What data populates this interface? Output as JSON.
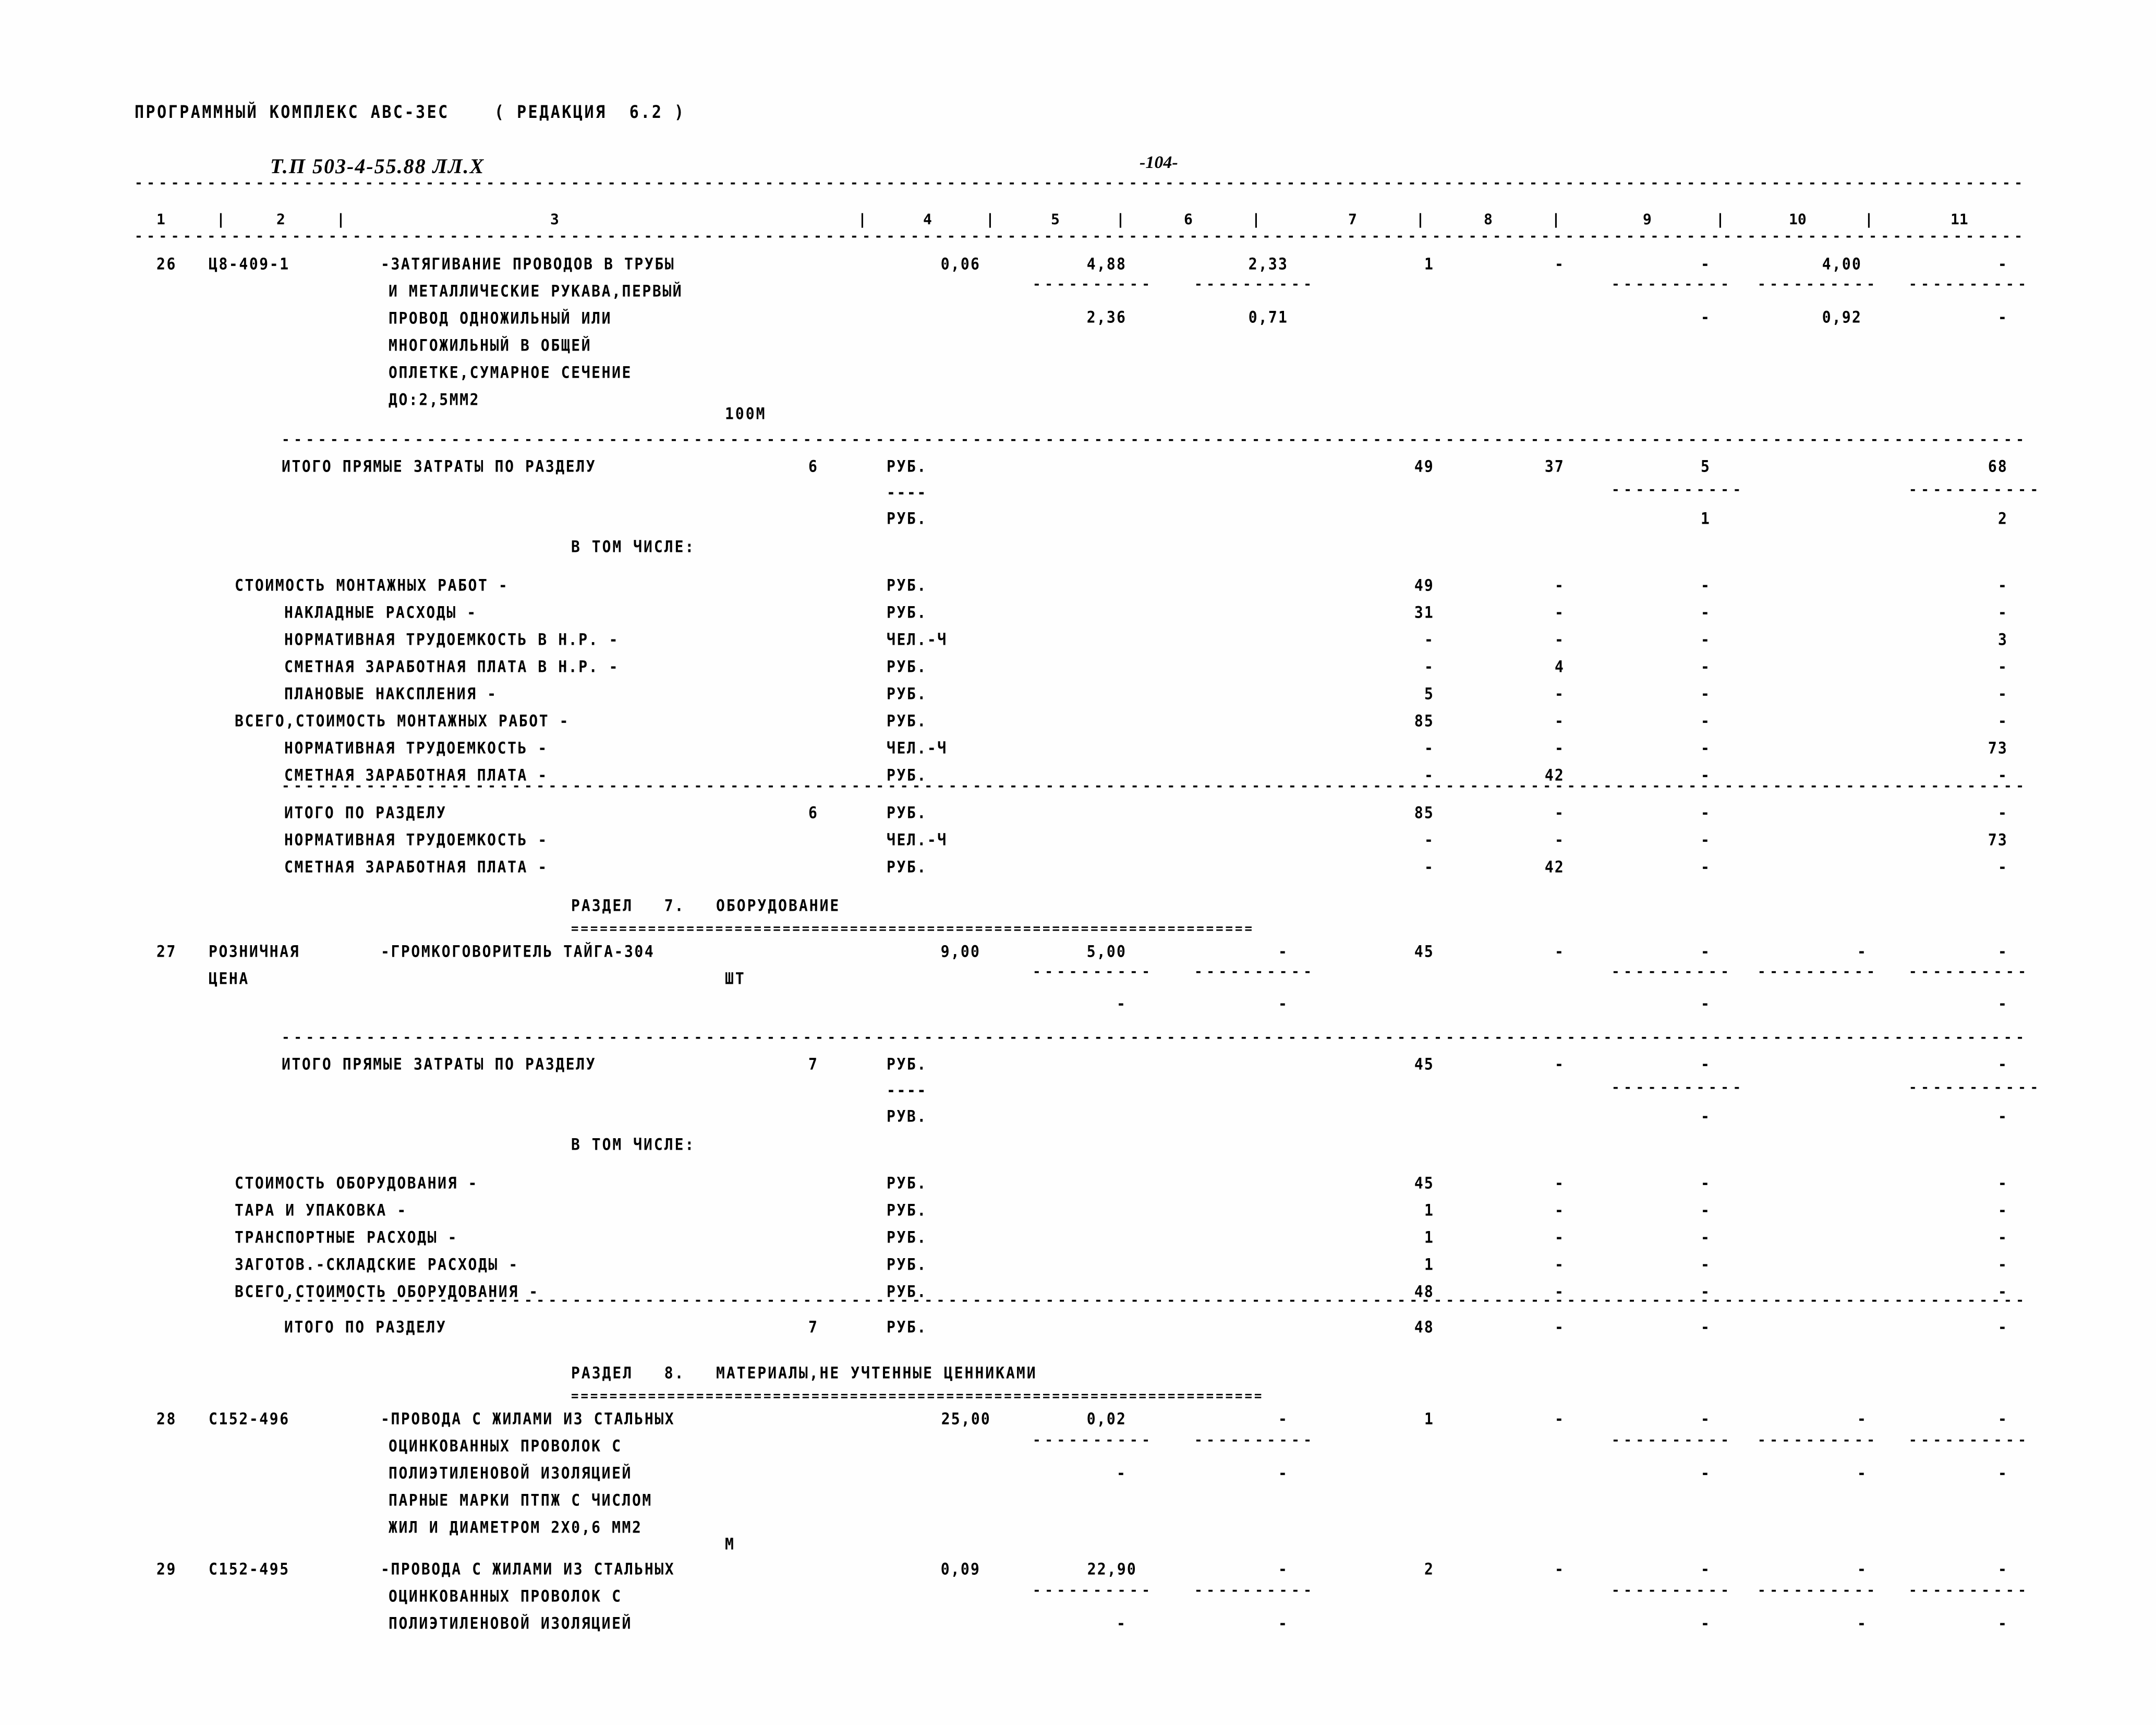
{
  "header": {
    "program_line": "ПРОГРАММНЫЙ КОМПЛЕКС АВС-ЗЕС    ( РЕДАКЦИЯ  6.2 )",
    "doc_code": "Т.П 503-4-55.88 ЛЛ.Х",
    "page_number": "-104-"
  },
  "column_headers": [
    "1",
    "2",
    "3",
    "4",
    "5",
    "6",
    "7",
    "8",
    "9",
    "10",
    "11"
  ],
  "rules": {
    "dash": "-",
    "equals": "="
  },
  "items": [
    {
      "no": "26",
      "code": "Ц8-409-1",
      "desc_lines": [
        "-ЗАТЯГИВАНИЕ ПРОВОДОВ В ТРУБЫ",
        "И МЕТАЛЛИЧЕСКИЕ РУКАВА,ПЕРВЫЙ",
        "ПРОВОД ОДНОЖИЛЬНЫЙ ИЛИ",
        "МНОГОЖИЛЬНЫЙ В ОБЩЕЙ",
        "ОПЛЕТКЕ,СУМАРНОЕ СЕЧЕНИЕ",
        "ДО:2,5ММ2"
      ],
      "unit": "100М",
      "row1": {
        "c4": "0,06",
        "c5": "4,88",
        "c6": "2,33",
        "c7": "1",
        "c8": "-",
        "c9": "-",
        "c10": "4,00",
        "c11": "-"
      },
      "row2": {
        "c5": "2,36",
        "c6": "0,71",
        "c9": "-",
        "c10": "0,92",
        "c11": "-"
      }
    },
    {
      "no": "27",
      "code": "РОЗНИЧНАЯ",
      "code2": "ЦЕНА",
      "desc_lines": [
        "-ГРОМКОГОВОРИТЕЛЬ ТАЙГА-304"
      ],
      "unit": "ШТ",
      "row1": {
        "c4": "9,00",
        "c5": "5,00",
        "c6": "-",
        "c7": "45",
        "c8": "-",
        "c9": "-",
        "c10": "-",
        "c11": "-"
      },
      "row2": {
        "c5": "-",
        "c6": "-"
      }
    },
    {
      "no": "28",
      "code": "С152-496",
      "desc_lines": [
        "-ПРОВОДА С ЖИЛАМИ ИЗ СТАЛЬНЫХ",
        "ОЦИНКОВАННЫХ ПРОВОЛОК С",
        "ПОЛИЭТИЛЕНОВОЙ ИЗОЛЯЦИЕЙ",
        "ПАРНЫЕ МАРКИ ПТПЖ С ЧИСЛОМ",
        "ЖИЛ И ДИАМЕТРОМ 2Х0,6 ММ2"
      ],
      "unit": "М",
      "row1": {
        "c4": "25,00",
        "c5": "0,02",
        "c6": "-",
        "c7": "1",
        "c8": "-",
        "c9": "-",
        "c10": "-",
        "c11": "-"
      },
      "row2": {
        "c5": "-",
        "c6": "-",
        "c9": "-",
        "c10": "-",
        "c11": "-"
      }
    },
    {
      "no": "29",
      "code": "С152-495",
      "desc_lines": [
        "-ПРОВОДА С ЖИЛАМИ ИЗ СТАЛЬНЫХ",
        "ОЦИНКОВАННЫХ ПРОВОЛОК С",
        "ПОЛИЭТИЛЕНОВОЙ ИЗОЛЯЦИЕЙ"
      ],
      "row1": {
        "c4": "0,09",
        "c5": "22,90",
        "c6": "-",
        "c7": "2",
        "c8": "-",
        "c9": "-",
        "c10": "-",
        "c11": "-"
      },
      "row2": {
        "c5": "-",
        "c6": "-",
        "c9": "-",
        "c10": "-",
        "c11": "-"
      }
    }
  ],
  "section6": {
    "total_direct_label": "ИТОГО ПРЯМЫЕ ЗАТРАТЫ ПО РАЗДЕЛУ",
    "total_direct_no": "6",
    "unit_rub": "РУБ.",
    "unit_rub2": "РУБ.",
    "dash_mark": "----",
    "values_main": {
      "c7": "49",
      "c8": "37",
      "c9": "5",
      "c11": "68"
    },
    "values_sub": {
      "c9": "1",
      "c11": "2"
    },
    "in_which_label": "В ТОМ ЧИСЛЕ:",
    "detail_rows": [
      {
        "label": "СТОИМОСТЬ МОНТАЖНЫХ РАБОТ -",
        "indent": 0,
        "unit": "РУБ.",
        "c7": "49",
        "c8": "-",
        "c9": "-",
        "c11": "-"
      },
      {
        "label": "НАКЛАДНЫЕ РАСХОДЫ -",
        "indent": 1,
        "unit": "РУБ.",
        "c7": "31",
        "c8": "-",
        "c9": "-",
        "c11": "-"
      },
      {
        "label": "НОРМАТИВНАЯ ТРУДОЕМКОСТЬ В Н.Р. -",
        "indent": 1,
        "unit": "ЧЕЛ.-Ч",
        "c7": "-",
        "c8": "-",
        "c9": "-",
        "c11": "3"
      },
      {
        "label": "СМЕТНАЯ ЗАРАБОТНАЯ ПЛАТА В Н.Р. -",
        "indent": 1,
        "unit": "РУБ.",
        "c7": "-",
        "c8": "4",
        "c9": "-",
        "c11": "-"
      },
      {
        "label": "ПЛАНОВЫЕ НАКСПЛЕНИЯ -",
        "indent": 1,
        "unit": "РУБ.",
        "c7": "5",
        "c8": "-",
        "c9": "-",
        "c11": "-"
      },
      {
        "label": "ВСЕГО,СТОИМОСТЬ МОНТАЖНЫХ РАБОТ -",
        "indent": 0,
        "unit": "РУБ.",
        "c7": "85",
        "c8": "-",
        "c9": "-",
        "c11": "-"
      },
      {
        "label": "НОРМАТИВНАЯ ТРУДОЕМКОСТЬ -",
        "indent": 1,
        "unit": "ЧЕЛ.-Ч",
        "c7": "-",
        "c8": "-",
        "c9": "-",
        "c11": "73"
      },
      {
        "label": "СМЕТНАЯ ЗАРАБОТНАЯ ПЛАТА -",
        "indent": 1,
        "unit": "РУБ.",
        "c7": "-",
        "c8": "42",
        "c9": "-",
        "c11": "-"
      }
    ],
    "total_rows": [
      {
        "label": "ИТОГО ПО РАЗДЕЛУ",
        "num": "6",
        "unit": "РУБ.",
        "c7": "85",
        "c8": "-",
        "c9": "-",
        "c11": "-"
      },
      {
        "label": "НОРМАТИВНАЯ ТРУДОЕМКОСТЬ -",
        "num": "",
        "unit": "ЧЕЛ.-Ч",
        "c7": "-",
        "c8": "-",
        "c9": "-",
        "c11": "73"
      },
      {
        "label": "СМЕТНАЯ ЗАРАБОТНАЯ ПЛАТА -",
        "num": "",
        "unit": "РУБ.",
        "c7": "-",
        "c8": "42",
        "c9": "-",
        "c11": "-"
      }
    ]
  },
  "section7": {
    "title": "РАЗДЕЛ   7.   ОБОРУДОВАНИЕ",
    "total_direct_label": "ИТОГО ПРЯМЫЕ ЗАТРАТЫ ПО РАЗДЕЛУ",
    "total_direct_no": "7",
    "unit_rub": "РУБ.",
    "unit_rub2": "РУВ.",
    "dash_mark": "----",
    "values_main": {
      "c7": "45",
      "c8": "-",
      "c9": "-",
      "c11": "-"
    },
    "values_sub": {
      "c9": "-",
      "c11": "-"
    },
    "in_which_label": "В ТОМ ЧИСЛЕ:",
    "detail_rows": [
      {
        "label": "СТОИМОСТЬ ОБОРУДОВАНИЯ -",
        "unit": "РУБ.",
        "c7": "45",
        "c8": "-",
        "c9": "-",
        "c11": "-"
      },
      {
        "label": "ТАРА И УПАКОВКА -",
        "unit": "РУБ.",
        "c7": "1",
        "c8": "-",
        "c9": "-",
        "c11": "-"
      },
      {
        "label": "ТРАНСПОРТНЫЕ РАСХОДЫ -",
        "unit": "РУБ.",
        "c7": "1",
        "c8": "-",
        "c9": "-",
        "c11": "-"
      },
      {
        "label": "ЗАГОТОВ.-СКЛАДСКИЕ РАСХОДЫ -",
        "unit": "РУБ.",
        "c7": "1",
        "c8": "-",
        "c9": "-",
        "c11": "-"
      },
      {
        "label": "ВСЕГО,СТОИМОСТЬ ОБОРУДОВАНИЯ -",
        "unit": "РУБ.",
        "c7": "48",
        "c8": "-",
        "c9": "-",
        "c11": "-"
      }
    ],
    "total_rows": [
      {
        "label": "ИТОГО ПО РАЗДЕЛУ",
        "num": "7",
        "unit": "РУБ.",
        "c7": "48",
        "c8": "-",
        "c9": "-",
        "c11": "-"
      }
    ]
  },
  "section8": {
    "title": "РАЗДЕЛ   8.   МАТЕРИАЛЫ,НЕ УЧТЕННЫЕ ЦЕННИКАМИ"
  }
}
